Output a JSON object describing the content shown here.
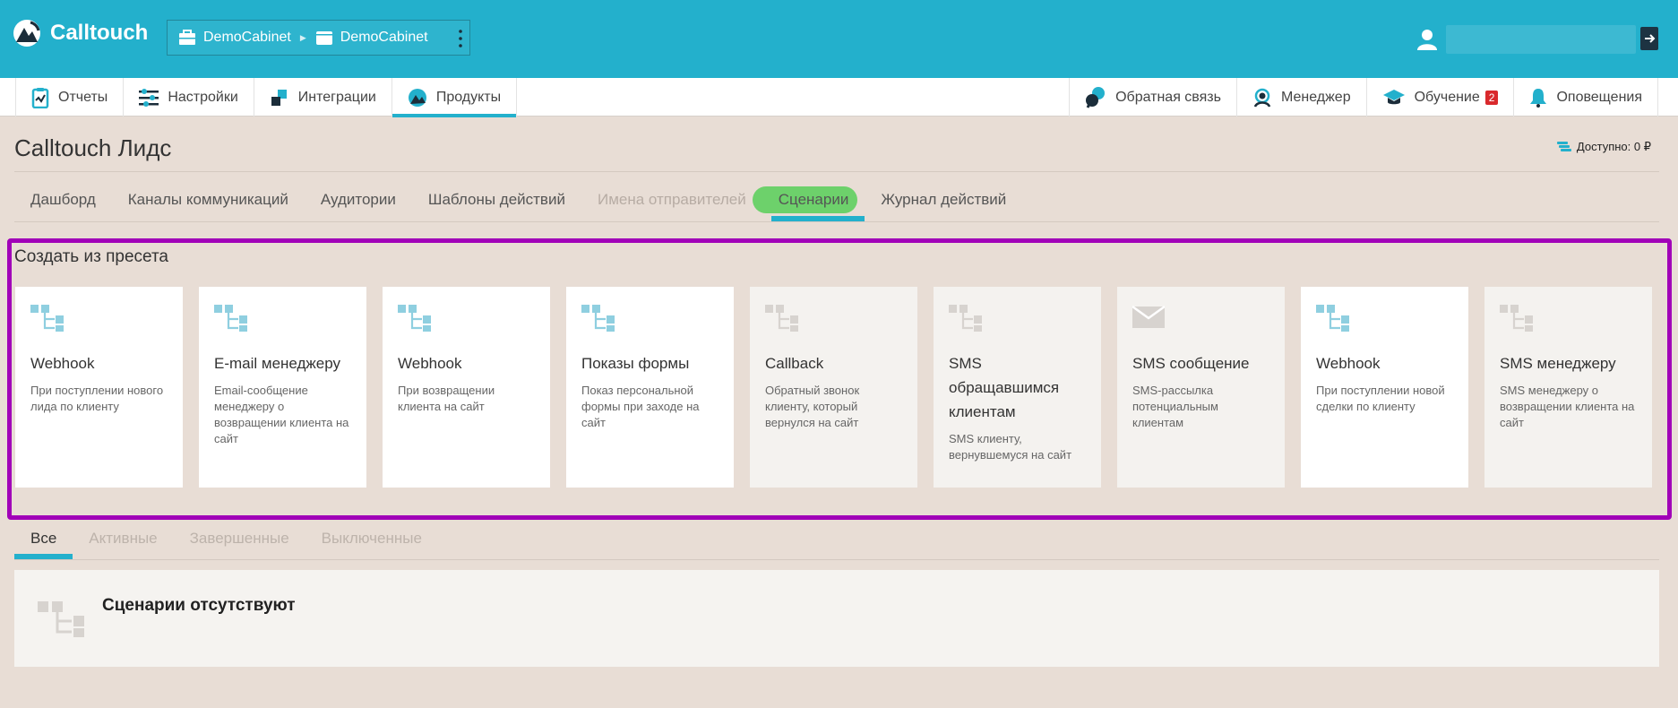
{
  "header": {
    "logo_text": "Calltouch",
    "cabinet": [
      "DemoCabinet",
      "DemoCabinet"
    ]
  },
  "nav": {
    "left": [
      {
        "label": "Отчеты",
        "icon": "report-icon"
      },
      {
        "label": "Настройки",
        "icon": "sliders-icon"
      },
      {
        "label": "Интеграции",
        "icon": "integration-icon"
      },
      {
        "label": "Продукты",
        "icon": "products-icon"
      }
    ],
    "right": [
      {
        "label": "Обратная связь",
        "icon": "feedback-icon"
      },
      {
        "label": "Менеджер",
        "icon": "manager-icon"
      },
      {
        "label": "Обучение",
        "icon": "graduation-cap-icon",
        "badge": "2"
      },
      {
        "label": "Оповещения",
        "icon": "bell-icon"
      }
    ]
  },
  "page": {
    "title": "Calltouch Лидс",
    "balance": "Доступно: 0 ₽"
  },
  "subtabs": [
    {
      "label": "Дашборд"
    },
    {
      "label": "Каналы коммуникаций"
    },
    {
      "label": "Аудитории"
    },
    {
      "label": "Шаблоны действий"
    },
    {
      "label": "Имена отправителей",
      "disabled": true
    },
    {
      "label": "Сценарии",
      "active": true
    },
    {
      "label": "Журнал действий"
    }
  ],
  "presets": {
    "title": "Создать из пресета",
    "cards": [
      {
        "title": "Webhook",
        "desc": "При поступлении нового лида по клиенту",
        "icon": "scenario-icon",
        "enabled": true
      },
      {
        "title": "E-mail менеджеру",
        "desc": "Email-сообщение менеджеру о возвращении клиента на сайт",
        "icon": "scenario-icon",
        "enabled": true
      },
      {
        "title": "Webhook",
        "desc": "При возвращении клиента на сайт",
        "icon": "scenario-icon",
        "enabled": true
      },
      {
        "title": "Показы формы",
        "desc": "Показ персональной формы при заходе на сайт",
        "icon": "scenario-icon",
        "enabled": true
      },
      {
        "title": "Callback",
        "desc": "Обратный звонок клиенту, который вернулся на сайт",
        "icon": "scenario-icon",
        "enabled": false
      },
      {
        "title": "SMS обращавшимся клиентам",
        "desc": "SMS клиенту, вернувшемуся на сайт",
        "icon": "scenario-icon",
        "enabled": false
      },
      {
        "title": "SMS сообщение",
        "desc": "SMS-рассылка потенциальным клиентам",
        "icon": "envelope-icon",
        "enabled": false
      },
      {
        "title": "Webhook",
        "desc": "При поступлении новой сделки по клиенту",
        "icon": "scenario-icon",
        "enabled": true
      },
      {
        "title": "SMS менеджеру",
        "desc": "SMS менеджеру о возвращении клиента на сайт",
        "icon": "scenario-icon",
        "enabled": false
      }
    ]
  },
  "list_tabs": [
    {
      "label": "Все",
      "active": true
    },
    {
      "label": "Активные"
    },
    {
      "label": "Завершенные"
    },
    {
      "label": "Выключенные"
    }
  ],
  "empty_state": {
    "text": "Сценарии отсутствуют"
  },
  "colors": {
    "brand": "#23b0cc",
    "highlight_frame": "#a100b8",
    "badge": "#d9292c"
  }
}
